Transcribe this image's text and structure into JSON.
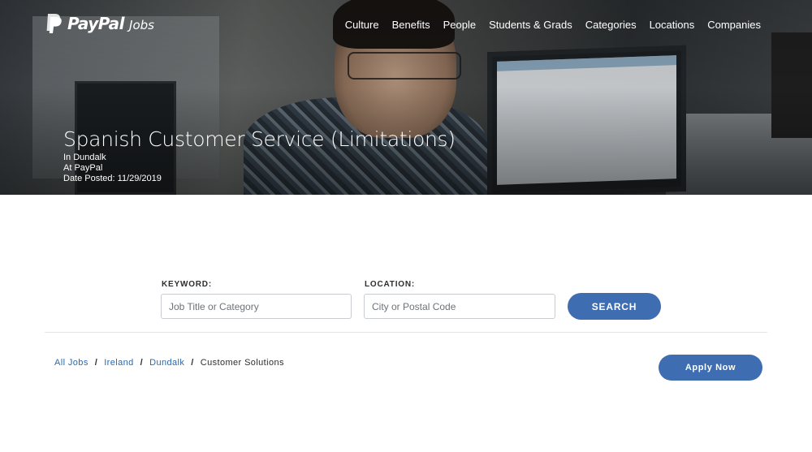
{
  "header": {
    "brand": "PayPal",
    "brand_suffix": "Jobs",
    "nav": [
      "Culture",
      "Benefits",
      "People",
      "Students & Grads",
      "Categories",
      "Locations",
      "Companies"
    ]
  },
  "job": {
    "title": "Spanish Customer Service (Limitations)",
    "location": "In Dundalk",
    "company": "At PayPal",
    "date_posted": "Date Posted: 11/29/2019"
  },
  "search": {
    "keyword_label": "KEYWORD:",
    "keyword_placeholder": "Job Title or Category",
    "location_label": "LOCATION:",
    "location_placeholder": "City or Postal Code",
    "button_label": "SEARCH"
  },
  "breadcrumb": {
    "items": [
      "All Jobs",
      "Ireland",
      "Dundalk"
    ],
    "current": "Customer Solutions",
    "separator": "/"
  },
  "apply": {
    "label": "Apply Now"
  },
  "colors": {
    "accent": "#3e6db2",
    "link": "#2c67aa"
  }
}
